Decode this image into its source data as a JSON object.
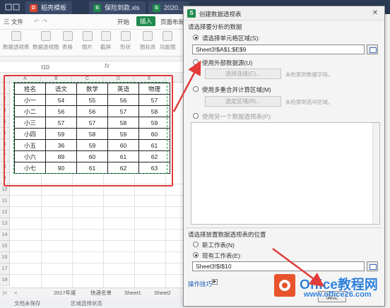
{
  "titlebar": {
    "tabs": [
      {
        "label": "稻壳模板",
        "icon": "D",
        "color": "#d9442e"
      },
      {
        "label": "保险到款.xls",
        "icon": "S",
        "color": "#1f8a4c"
      },
      {
        "label": "2020...",
        "icon": "S",
        "color": "#1f8a4c"
      }
    ]
  },
  "menubar": {
    "file": "三 文件",
    "start": "开始",
    "insert": "插入",
    "layout": "页面布局"
  },
  "ribbon": {
    "items": [
      "数据透视表",
      "数据透视图",
      "表格",
      "图片",
      "截屏",
      "形状",
      "图标库",
      "功能图"
    ]
  },
  "formulabar": {
    "cell_ref": "I10",
    "fx": "fx"
  },
  "sheet": {
    "columns": [
      "A",
      "B",
      "C",
      "D",
      "E"
    ],
    "rows": [
      "1",
      "2",
      "3",
      "4",
      "5",
      "6",
      "7",
      "8",
      "9",
      "10",
      "11",
      "12",
      "13",
      "14",
      "15",
      "16",
      "17",
      "18"
    ],
    "table": [
      [
        "姓名",
        "语文",
        "数学",
        "英语",
        "物理"
      ],
      [
        "小一",
        "54",
        "55",
        "56",
        "57"
      ],
      [
        "小二",
        "56",
        "56",
        "57",
        "58"
      ],
      [
        "小三",
        "57",
        "57",
        "58",
        "59"
      ],
      [
        "小四",
        "59",
        "58",
        "59",
        "60"
      ],
      [
        "小五",
        "36",
        "59",
        "60",
        "61"
      ],
      [
        "小六",
        "89",
        "60",
        "61",
        "62"
      ],
      [
        "小七",
        "90",
        "61",
        "62",
        "63"
      ]
    ]
  },
  "sheet_tabs": [
    "2017年度",
    "快递名单",
    "Sheet1",
    "Sheet2"
  ],
  "statusbar": {
    "doc_status": "文档未保存",
    "mode": "区域选择状态"
  },
  "dialog": {
    "title": "创建数据透视表",
    "close": "✕",
    "section1": "请选择要分析的数据",
    "opt_range": "请选择单元格区域(S):",
    "range_value": "Sheet3!$A$1:$E$9",
    "opt_external": "使用外部数据源(U)",
    "btn_choose_conn": "选择连接(C)...",
    "hint_no_fields": "未检索到数据字段。",
    "opt_multi": "使用多重合并计算区域(M)",
    "btn_choose_area": "选定区域(R)...",
    "hint_no_area": "未检索到选中区域。",
    "opt_other_pivot": "使用另一个数据透视表(P):",
    "section2": "请选择放置数据透视表的位置",
    "opt_new_sheet": "新工作表(N)",
    "opt_existing": "现有工作表(E):",
    "existing_value": "Sheet3!$I$10",
    "tips_link": "操作技巧",
    "ok_label": "确定"
  },
  "watermark": {
    "brand": "Office教程网",
    "url": "www.office26.com"
  },
  "colors": {
    "accent": "#1f8a4c",
    "highlight": "#e23b3b",
    "arrow": "#e23b3b"
  }
}
